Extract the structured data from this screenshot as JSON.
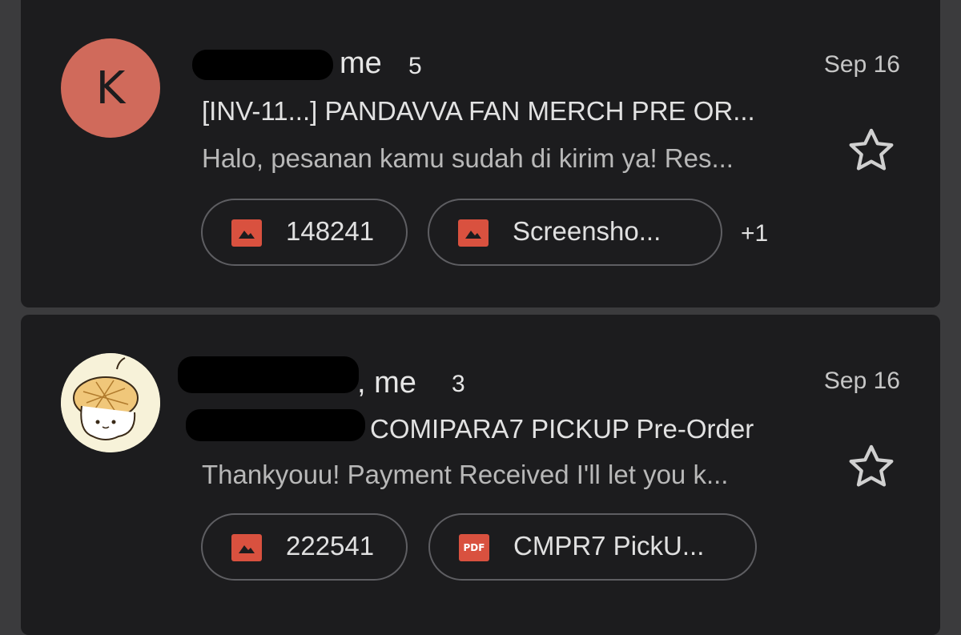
{
  "threads": [
    {
      "avatar_letter": "K",
      "sender": "me",
      "count": "5",
      "date": "Sep 16",
      "subject": "[INV-11...] PANDAVVA FAN MERCH PRE OR...",
      "snippet": "Halo, pesanan kamu sudah di kirim ya! Res...",
      "attachments": [
        {
          "type": "image",
          "name": "148241"
        },
        {
          "type": "image",
          "name": "Screensho..."
        }
      ],
      "more_attachments": "+1"
    },
    {
      "avatar_letter": "",
      "sender": ", me",
      "count": "3",
      "date": "Sep 16",
      "subject": "COMIPARA7 PICKUP Pre-Order",
      "snippet": "Thankyouu! Payment Received I'll let you k...",
      "attachments": [
        {
          "type": "image",
          "name": "222541"
        },
        {
          "type": "pdf",
          "name": "CMPR7 PickU...",
          "badge": "PDF"
        }
      ]
    }
  ],
  "colors": {
    "background": "#3b3b3d",
    "card": "#1c1c1e",
    "avatar_k": "#d06a5b",
    "attachment_icon": "#d9513f"
  }
}
